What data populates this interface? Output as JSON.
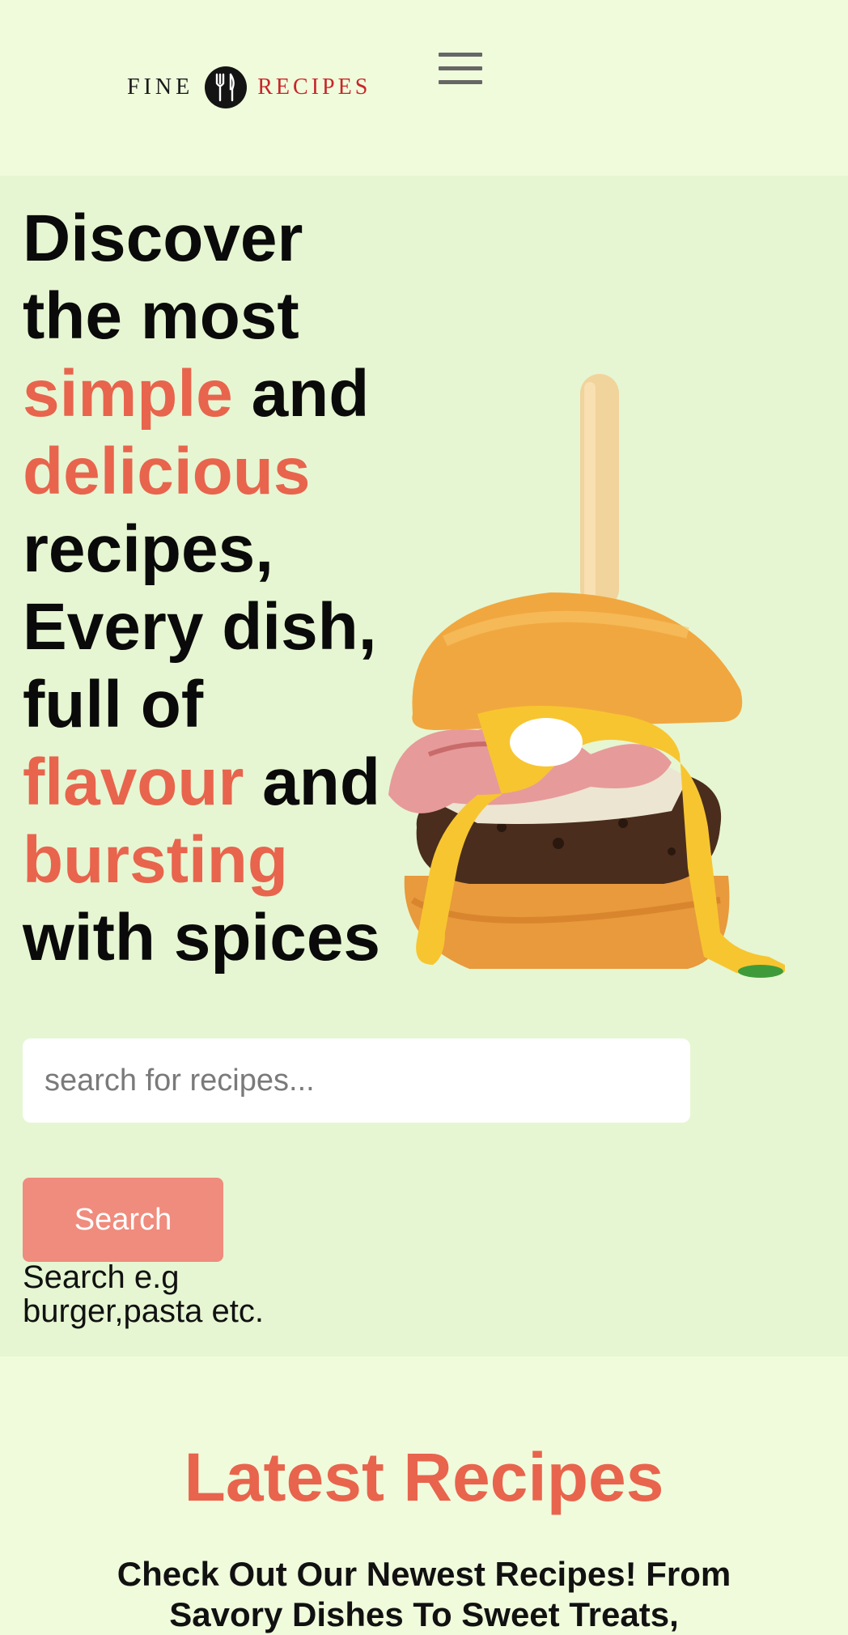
{
  "header": {
    "logo": {
      "left_text": "FINE",
      "right_text": "RECIPES",
      "badge_icon": "fork-knife-icon",
      "left_color": "#1a1a1a",
      "right_color": "#c8262a"
    },
    "menu_icon": "hamburger-menu-icon"
  },
  "hero": {
    "title": {
      "line1": "Discover",
      "line2": "the most",
      "line3_accent": "simple",
      "line3_rest": " and",
      "line4_accent": "delicious",
      "line5": "recipes,",
      "line6": "Every dish,",
      "line7": "full of",
      "line8_accent": "flavour",
      "line8_rest": " and",
      "line9_accent": "bursting",
      "line10": "with spices"
    },
    "image": "burger-with-knife-image",
    "search": {
      "placeholder": "search for recipes...",
      "value": "",
      "button_label": "Search",
      "hint_line1": "Search e.g",
      "hint_line2": "burger,pasta etc."
    }
  },
  "latest": {
    "title": "Latest Recipes",
    "subtitle_line1": "Check Out Our Newest Recipes! From",
    "subtitle_line2": "Savory Dishes To Sweet Treats,"
  },
  "colors": {
    "page_bg": "#f0fbdc",
    "hero_bg": "#e6f6d2",
    "accent": "#e8644d",
    "button_bg": "#ef8c7d",
    "text": "#0a0a0a"
  }
}
